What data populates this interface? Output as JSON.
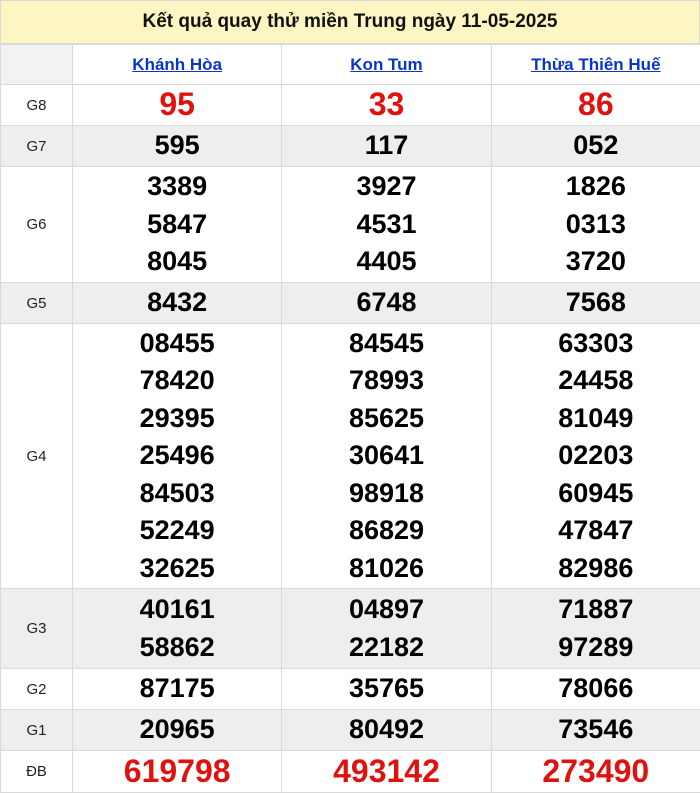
{
  "title": "Kết quả quay thử miền Trung ngày 11-05-2025",
  "provinces": [
    "Khánh Hòa",
    "Kon Tum",
    "Thừa Thiên Huế"
  ],
  "rows": {
    "g8": {
      "label": "G8",
      "values": [
        [
          "95"
        ],
        [
          "33"
        ],
        [
          "86"
        ]
      ]
    },
    "g7": {
      "label": "G7",
      "values": [
        [
          "595"
        ],
        [
          "117"
        ],
        [
          "052"
        ]
      ]
    },
    "g6": {
      "label": "G6",
      "values": [
        [
          "3389",
          "5847",
          "8045"
        ],
        [
          "3927",
          "4531",
          "4405"
        ],
        [
          "1826",
          "0313",
          "3720"
        ]
      ]
    },
    "g5": {
      "label": "G5",
      "values": [
        [
          "8432"
        ],
        [
          "6748"
        ],
        [
          "7568"
        ]
      ]
    },
    "g4": {
      "label": "G4",
      "values": [
        [
          "08455",
          "78420",
          "29395",
          "25496",
          "84503",
          "52249",
          "32625"
        ],
        [
          "84545",
          "78993",
          "85625",
          "30641",
          "98918",
          "86829",
          "81026"
        ],
        [
          "63303",
          "24458",
          "81049",
          "02203",
          "60945",
          "47847",
          "82986"
        ]
      ]
    },
    "g3": {
      "label": "G3",
      "values": [
        [
          "40161",
          "58862"
        ],
        [
          "04897",
          "22182"
        ],
        [
          "71887",
          "97289"
        ]
      ]
    },
    "g2": {
      "label": "G2",
      "values": [
        [
          "87175"
        ],
        [
          "35765"
        ],
        [
          "78066"
        ]
      ]
    },
    "g1": {
      "label": "G1",
      "values": [
        [
          "20965"
        ],
        [
          "80492"
        ],
        [
          "73546"
        ]
      ]
    },
    "db": {
      "label": "ĐB",
      "values": [
        [
          "619798"
        ],
        [
          "493142"
        ],
        [
          "273490"
        ]
      ]
    }
  },
  "colors": {
    "title_bg": "#fdf6c3",
    "link": "#0b35c9",
    "highlight": "#e0120f",
    "alt_row": "#eeeeee"
  }
}
